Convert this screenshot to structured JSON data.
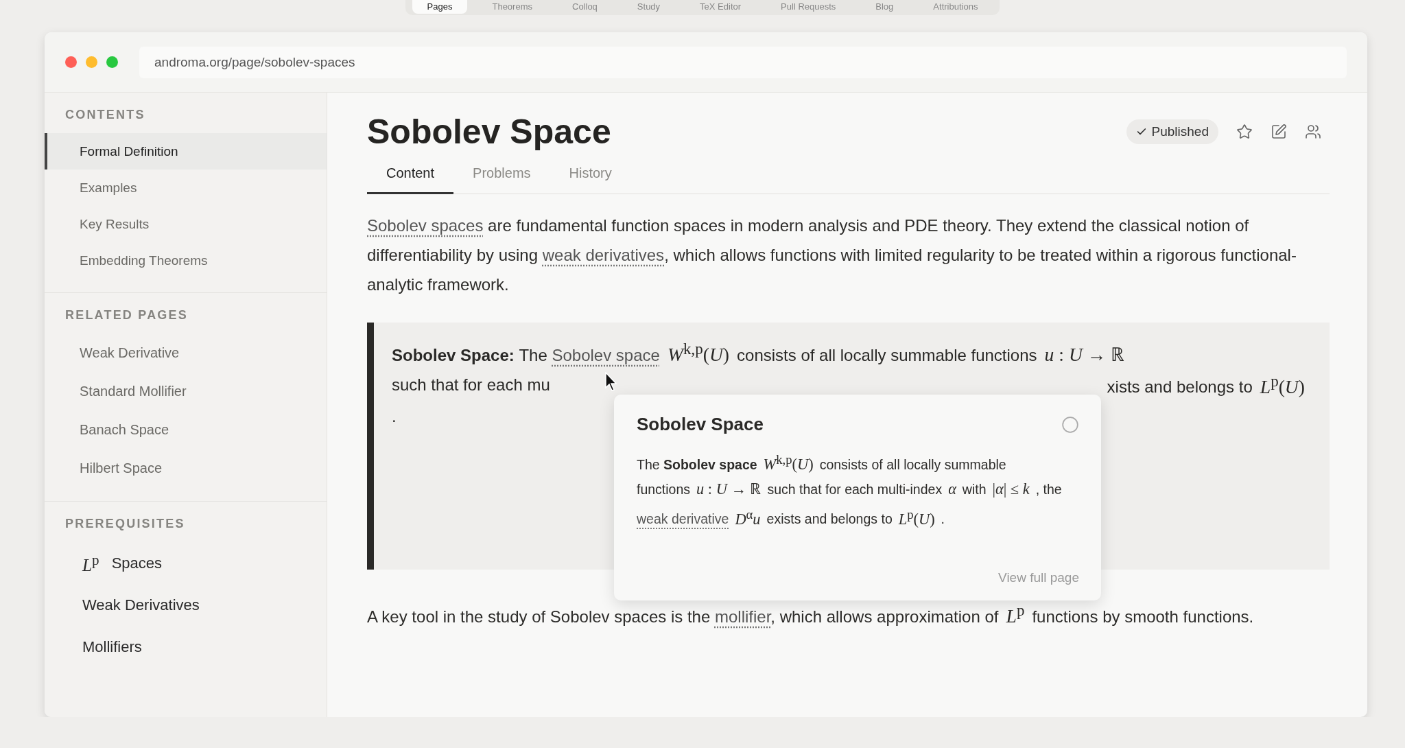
{
  "top_nav": {
    "tabs": [
      {
        "label": "Pages",
        "selected": true
      },
      {
        "label": "Theorems",
        "selected": false
      },
      {
        "label": "Colloq",
        "selected": false
      },
      {
        "label": "Study",
        "selected": false
      },
      {
        "label": "TeX Editor",
        "selected": false
      },
      {
        "label": "Pull Requests",
        "selected": false
      },
      {
        "label": "Blog",
        "selected": false
      },
      {
        "label": "Attributions",
        "selected": false
      }
    ]
  },
  "browser": {
    "url": "androma.org/page/sobolev-spaces"
  },
  "sidebar": {
    "sections": [
      {
        "heading": "CONTENTS",
        "kind": "toc",
        "items": [
          {
            "label": "Formal Definition",
            "selected": true
          },
          {
            "label": "Examples",
            "selected": false
          },
          {
            "label": "Key Results",
            "selected": false
          },
          {
            "label": "Embedding Theorems",
            "selected": false
          }
        ]
      },
      {
        "heading": "RELATED PAGES",
        "kind": "links",
        "items": [
          {
            "label": "Weak Derivative"
          },
          {
            "label": "Standard Mollifier"
          },
          {
            "label": "Banach Space"
          },
          {
            "label": "Hilbert Space"
          }
        ]
      },
      {
        "heading": "PREREQUISITES",
        "kind": "prereq",
        "items": [
          {
            "math": "*L*$^{p}$",
            "label": "Spaces"
          },
          {
            "label": "Weak Derivatives"
          },
          {
            "label": "Mollifiers"
          }
        ]
      }
    ]
  },
  "page": {
    "title": "Sobolev Space",
    "status": "Published",
    "tabs": [
      {
        "label": "Content",
        "selected": true
      },
      {
        "label": "Problems",
        "selected": false
      },
      {
        "label": "History",
        "selected": false
      }
    ],
    "intro": [
      {
        "kind": "link",
        "text": "Sobolev spaces"
      },
      {
        "kind": "text",
        "text": " are fundamental function spaces in modern analysis and PDE theory. They extend the classical notion of differentiability by using "
      },
      {
        "kind": "link",
        "text": "weak derivatives"
      },
      {
        "kind": "text",
        "text": ", which allows functions with limited regularity to be treated within a rigorous functional-analytic framework."
      }
    ],
    "definition": {
      "label": "Sobolev Space:",
      "lines": [
        {
          "left": [
            {
              "kind": "text",
              "text": "The "
            },
            {
              "kind": "link",
              "text": "Sobolev space"
            },
            {
              "kind": "math",
              "text": "*W*$^{k,p}$(*U*)"
            },
            {
              "kind": "text",
              "text": "consists of all locally summable functions"
            },
            {
              "kind": "math",
              "text": "*u* : *U* → ℝ"
            }
          ]
        },
        {
          "left": [
            {
              "kind": "text",
              "text": "such that for each mu"
            }
          ],
          "right": [
            {
              "kind": "text",
              "text": "xists and belongs to"
            },
            {
              "kind": "math",
              "text": "*L*$^{p}$(*U*)"
            }
          ]
        },
        {
          "left": [
            {
              "kind": "text",
              "text": "."
            }
          ]
        }
      ]
    },
    "preview": {
      "title": "Sobolev Space",
      "body": [
        {
          "kind": "text",
          "text": "The "
        },
        {
          "kind": "bold",
          "text": "Sobolev space"
        },
        {
          "kind": "math",
          "text": "*W*$^{k,p}$(*U*)"
        },
        {
          "kind": "text",
          "text": "consists of all locally summable functions"
        },
        {
          "kind": "math",
          "text": "*u* : *U* → ℝ"
        },
        {
          "kind": "text",
          "text": "such that for each multi-index"
        },
        {
          "kind": "math",
          "text": "*α*"
        },
        {
          "kind": "text",
          "text": "with"
        },
        {
          "kind": "math",
          "text": "|*α*| ≤ *k*"
        },
        {
          "kind": "text",
          "text": ", the "
        },
        {
          "kind": "link",
          "text": "weak derivative"
        },
        {
          "kind": "math",
          "text": "*D*$^{α}$*u*"
        },
        {
          "kind": "text",
          "text": "exists and belongs to"
        },
        {
          "kind": "math",
          "text": "*L*$^{p}$(*U*)"
        },
        {
          "kind": "text",
          "text": "."
        }
      ],
      "action": "View full page"
    },
    "closing": [
      {
        "kind": "text",
        "text": "A key tool in the study of Sobolev spaces is the "
      },
      {
        "kind": "link",
        "text": "mollifier"
      },
      {
        "kind": "text",
        "text": ", which allows approximation of"
      },
      {
        "kind": "math",
        "text": "*L*$^{p}$"
      },
      {
        "kind": "text",
        "text": "functions by smooth functions."
      }
    ]
  }
}
